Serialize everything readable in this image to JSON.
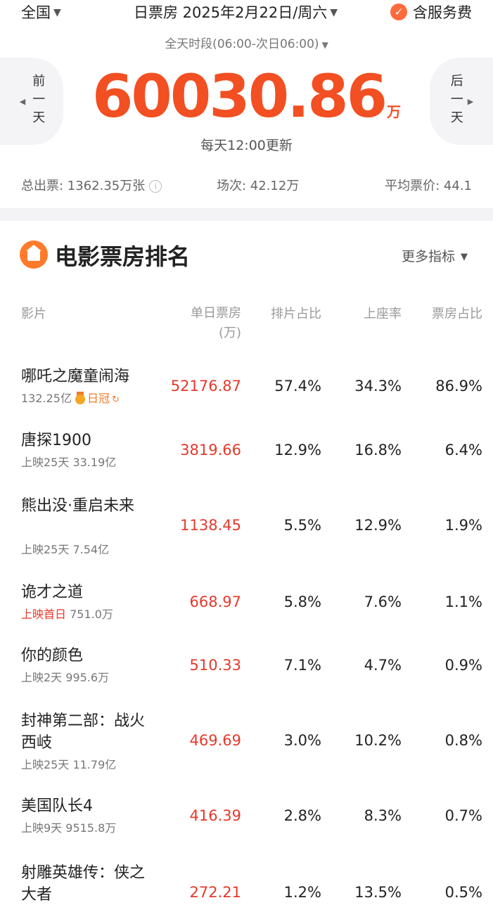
{
  "header": {
    "region": "全国",
    "date_selector": "日票房 2025年2月22日/周六",
    "service_fee_label": "含服务费",
    "period": "全天时段(06:00-次日06:00)",
    "prev_label": "前一天",
    "next_label": "后一天",
    "total_value": "60030.86",
    "total_unit": "万",
    "update_note": "每天12:00更新"
  },
  "stats": {
    "tickets": "总出票: 1362.35万张",
    "screenings": "场次: 42.12万",
    "avg_price": "平均票价: 44.1"
  },
  "ranking": {
    "title": "电影票房排名",
    "more_label": "更多指标",
    "columns": {
      "film": "影片",
      "daily": "单日票房",
      "daily_unit": "(万)",
      "schedule": "排片占比",
      "seat": "上座率",
      "share": "票房占比"
    },
    "rows": [
      {
        "name": "哪吒之魔童闹海",
        "sub_plain": "132.25亿",
        "badge": "日冠",
        "badge_suffix": "↻",
        "daily": "52176.87",
        "schedule": "57.4%",
        "seat": "34.3%",
        "share": "86.9%"
      },
      {
        "name": "唐探1900",
        "sub_plain": "上映25天 33.19亿",
        "daily": "3819.66",
        "schedule": "12.9%",
        "seat": "16.8%",
        "share": "6.4%"
      },
      {
        "name": "熊出没·重启未来",
        "sub_plain": "上映25天 7.54亿",
        "daily": "1138.45",
        "schedule": "5.5%",
        "seat": "12.9%",
        "share": "1.9%"
      },
      {
        "name": "诡才之道",
        "sub_highlight": "上映首日",
        "sub_plain": "751.0万",
        "daily": "668.97",
        "schedule": "5.8%",
        "seat": "7.6%",
        "share": "1.1%"
      },
      {
        "name": "你的颜色",
        "sub_plain": "上映2天 995.6万",
        "daily": "510.33",
        "schedule": "7.1%",
        "seat": "4.7%",
        "share": "0.9%"
      },
      {
        "name": "封神第二部：战火西岐",
        "sub_plain": "上映25天 11.79亿",
        "daily": "469.69",
        "schedule": "3.0%",
        "seat": "10.2%",
        "share": "0.8%"
      },
      {
        "name": "美国队长4",
        "sub_plain": "上映9天 9515.8万",
        "daily": "416.39",
        "schedule": "2.8%",
        "seat": "8.3%",
        "share": "0.7%"
      },
      {
        "name": "射雕英雄传：侠之大者",
        "sub_plain": "",
        "daily": "272.21",
        "schedule": "1.2%",
        "seat": "13.5%",
        "share": "0.5%"
      }
    ]
  },
  "colors": {
    "accent": "#f24f22",
    "value_red": "#e5392b",
    "section_icon": "#ff7a2b"
  }
}
